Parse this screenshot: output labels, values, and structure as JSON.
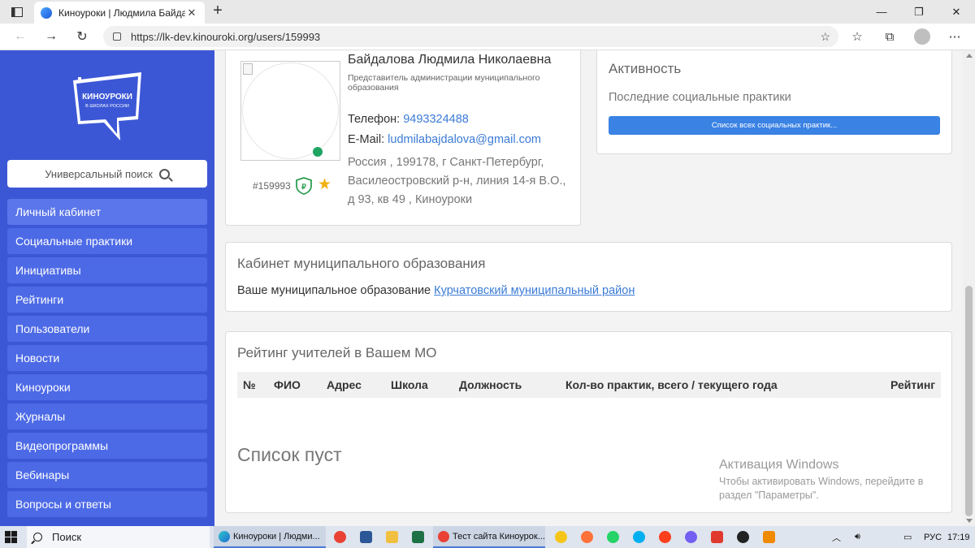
{
  "browser": {
    "tab_title": "Киноуроки | Людмила Байдалова",
    "tab_close": "✕",
    "new_tab": "+",
    "url": "https://lk-dev.kinouroki.org/users/159993",
    "window_controls": {
      "minimize": "—",
      "maximize": "❐",
      "close": "✕"
    }
  },
  "sidebar": {
    "logo_text": [
      "КИНОУРОКИ",
      "В ШКОЛАХ РОССИИ"
    ],
    "search_placeholder": "Универсальный поиск",
    "items": [
      {
        "label": "Личный кабинет",
        "active": true
      },
      {
        "label": "Социальные практики"
      },
      {
        "label": "Инициативы"
      },
      {
        "label": "Рейтинги"
      },
      {
        "label": "Пользователи"
      },
      {
        "label": "Новости"
      },
      {
        "label": "Киноуроки"
      },
      {
        "label": "Журналы"
      },
      {
        "label": "Видеопрограммы"
      },
      {
        "label": "Вебинары"
      },
      {
        "label": "Вопросы и ответы"
      }
    ]
  },
  "profile": {
    "name": "Байдалова Людмила Николаевна",
    "role": "Представитель администрации муниципального образования",
    "phone_label": "Телефон:",
    "phone": "9493324488",
    "email_label": "E-Mail:",
    "email": "ludmilabajdalova@gmail.com",
    "address": "Россия , 199178, г Санкт-Петербург, Василеостровский р-н, линия 14-я В.О., д 93, кв 49 , Киноуроки",
    "user_id": "#159993",
    "online_color": "#1fa463"
  },
  "activity": {
    "title": "Активность",
    "subtitle": "Последние социальные практики",
    "button": "Список всех социальных практик..."
  },
  "municipality": {
    "title": "Кабинет муниципального образования",
    "text": "Ваше муниципальное образование",
    "link": "Курчатовский муниципальный район"
  },
  "rating": {
    "title": "Рейтинг учителей в Вашем МО",
    "columns": [
      "№",
      "ФИО",
      "Адрес",
      "Школа",
      "Должность",
      "Кол-во практик, всего / текущего года",
      "Рейтинг"
    ],
    "empty": "Список пуст"
  },
  "watermark": {
    "title": "Активация Windows",
    "text_line1": "Чтобы активировать Windows, перейдите в",
    "text_line2": "раздел \"Параметры\"."
  },
  "taskbar": {
    "search": "Поиск",
    "tasks": [
      "Киноуроки | Людми...",
      "Тест сайта Киноурок..."
    ],
    "lang": "РУС",
    "time": "17:19"
  },
  "colors": {
    "sidebar": "#3c57d6",
    "menu_item": "#4d6ae6",
    "accent": "#3a82e4",
    "link": "#3b7bd6"
  }
}
